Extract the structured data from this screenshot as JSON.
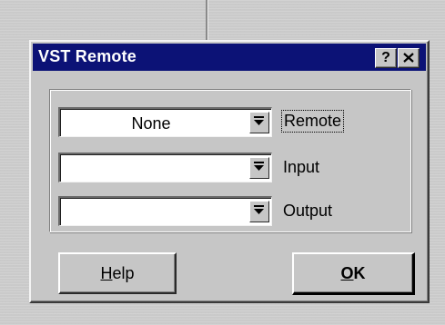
{
  "dialog": {
    "title": "VST Remote",
    "help_glyph": "?",
    "close_icon": "close-icon"
  },
  "fields": [
    {
      "value": "None",
      "label": "Remote"
    },
    {
      "value": "",
      "label": "Input"
    },
    {
      "value": "",
      "label": "Output"
    }
  ],
  "buttons": {
    "help_mnemonic": "H",
    "help_rest": "elp",
    "ok_mnemonic": "O",
    "ok_rest": "K"
  },
  "colors": {
    "titlebar": "#0c1276",
    "dialog_bg": "#c6c6c6"
  }
}
